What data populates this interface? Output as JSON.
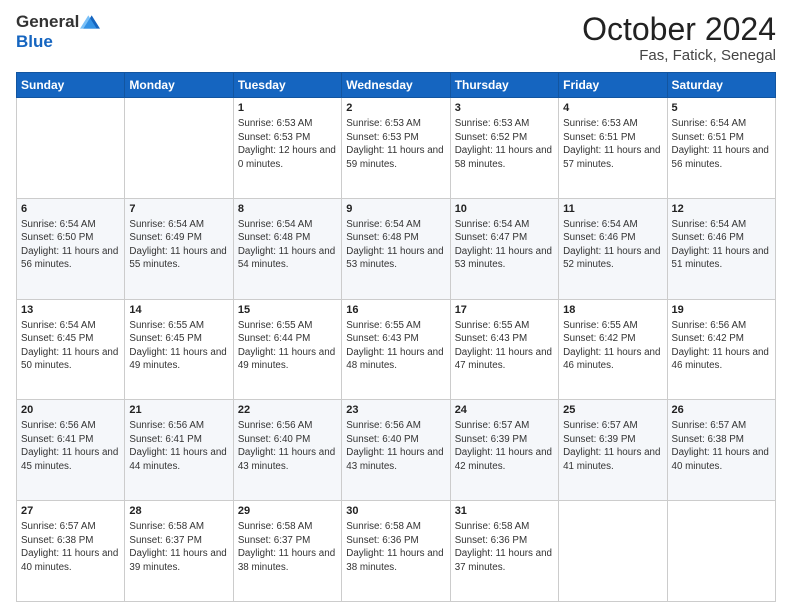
{
  "header": {
    "logo_line1": "General",
    "logo_line2": "Blue",
    "title": "October 2024",
    "subtitle": "Fas, Fatick, Senegal"
  },
  "days_of_week": [
    "Sunday",
    "Monday",
    "Tuesday",
    "Wednesday",
    "Thursday",
    "Friday",
    "Saturday"
  ],
  "weeks": [
    [
      {
        "day": "",
        "info": ""
      },
      {
        "day": "",
        "info": ""
      },
      {
        "day": "1",
        "info": "Sunrise: 6:53 AM\nSunset: 6:53 PM\nDaylight: 12 hours and 0 minutes."
      },
      {
        "day": "2",
        "info": "Sunrise: 6:53 AM\nSunset: 6:53 PM\nDaylight: 11 hours and 59 minutes."
      },
      {
        "day": "3",
        "info": "Sunrise: 6:53 AM\nSunset: 6:52 PM\nDaylight: 11 hours and 58 minutes."
      },
      {
        "day": "4",
        "info": "Sunrise: 6:53 AM\nSunset: 6:51 PM\nDaylight: 11 hours and 57 minutes."
      },
      {
        "day": "5",
        "info": "Sunrise: 6:54 AM\nSunset: 6:51 PM\nDaylight: 11 hours and 56 minutes."
      }
    ],
    [
      {
        "day": "6",
        "info": "Sunrise: 6:54 AM\nSunset: 6:50 PM\nDaylight: 11 hours and 56 minutes."
      },
      {
        "day": "7",
        "info": "Sunrise: 6:54 AM\nSunset: 6:49 PM\nDaylight: 11 hours and 55 minutes."
      },
      {
        "day": "8",
        "info": "Sunrise: 6:54 AM\nSunset: 6:48 PM\nDaylight: 11 hours and 54 minutes."
      },
      {
        "day": "9",
        "info": "Sunrise: 6:54 AM\nSunset: 6:48 PM\nDaylight: 11 hours and 53 minutes."
      },
      {
        "day": "10",
        "info": "Sunrise: 6:54 AM\nSunset: 6:47 PM\nDaylight: 11 hours and 53 minutes."
      },
      {
        "day": "11",
        "info": "Sunrise: 6:54 AM\nSunset: 6:46 PM\nDaylight: 11 hours and 52 minutes."
      },
      {
        "day": "12",
        "info": "Sunrise: 6:54 AM\nSunset: 6:46 PM\nDaylight: 11 hours and 51 minutes."
      }
    ],
    [
      {
        "day": "13",
        "info": "Sunrise: 6:54 AM\nSunset: 6:45 PM\nDaylight: 11 hours and 50 minutes."
      },
      {
        "day": "14",
        "info": "Sunrise: 6:55 AM\nSunset: 6:45 PM\nDaylight: 11 hours and 49 minutes."
      },
      {
        "day": "15",
        "info": "Sunrise: 6:55 AM\nSunset: 6:44 PM\nDaylight: 11 hours and 49 minutes."
      },
      {
        "day": "16",
        "info": "Sunrise: 6:55 AM\nSunset: 6:43 PM\nDaylight: 11 hours and 48 minutes."
      },
      {
        "day": "17",
        "info": "Sunrise: 6:55 AM\nSunset: 6:43 PM\nDaylight: 11 hours and 47 minutes."
      },
      {
        "day": "18",
        "info": "Sunrise: 6:55 AM\nSunset: 6:42 PM\nDaylight: 11 hours and 46 minutes."
      },
      {
        "day": "19",
        "info": "Sunrise: 6:56 AM\nSunset: 6:42 PM\nDaylight: 11 hours and 46 minutes."
      }
    ],
    [
      {
        "day": "20",
        "info": "Sunrise: 6:56 AM\nSunset: 6:41 PM\nDaylight: 11 hours and 45 minutes."
      },
      {
        "day": "21",
        "info": "Sunrise: 6:56 AM\nSunset: 6:41 PM\nDaylight: 11 hours and 44 minutes."
      },
      {
        "day": "22",
        "info": "Sunrise: 6:56 AM\nSunset: 6:40 PM\nDaylight: 11 hours and 43 minutes."
      },
      {
        "day": "23",
        "info": "Sunrise: 6:56 AM\nSunset: 6:40 PM\nDaylight: 11 hours and 43 minutes."
      },
      {
        "day": "24",
        "info": "Sunrise: 6:57 AM\nSunset: 6:39 PM\nDaylight: 11 hours and 42 minutes."
      },
      {
        "day": "25",
        "info": "Sunrise: 6:57 AM\nSunset: 6:39 PM\nDaylight: 11 hours and 41 minutes."
      },
      {
        "day": "26",
        "info": "Sunrise: 6:57 AM\nSunset: 6:38 PM\nDaylight: 11 hours and 40 minutes."
      }
    ],
    [
      {
        "day": "27",
        "info": "Sunrise: 6:57 AM\nSunset: 6:38 PM\nDaylight: 11 hours and 40 minutes."
      },
      {
        "day": "28",
        "info": "Sunrise: 6:58 AM\nSunset: 6:37 PM\nDaylight: 11 hours and 39 minutes."
      },
      {
        "day": "29",
        "info": "Sunrise: 6:58 AM\nSunset: 6:37 PM\nDaylight: 11 hours and 38 minutes."
      },
      {
        "day": "30",
        "info": "Sunrise: 6:58 AM\nSunset: 6:36 PM\nDaylight: 11 hours and 38 minutes."
      },
      {
        "day": "31",
        "info": "Sunrise: 6:58 AM\nSunset: 6:36 PM\nDaylight: 11 hours and 37 minutes."
      },
      {
        "day": "",
        "info": ""
      },
      {
        "day": "",
        "info": ""
      }
    ]
  ]
}
